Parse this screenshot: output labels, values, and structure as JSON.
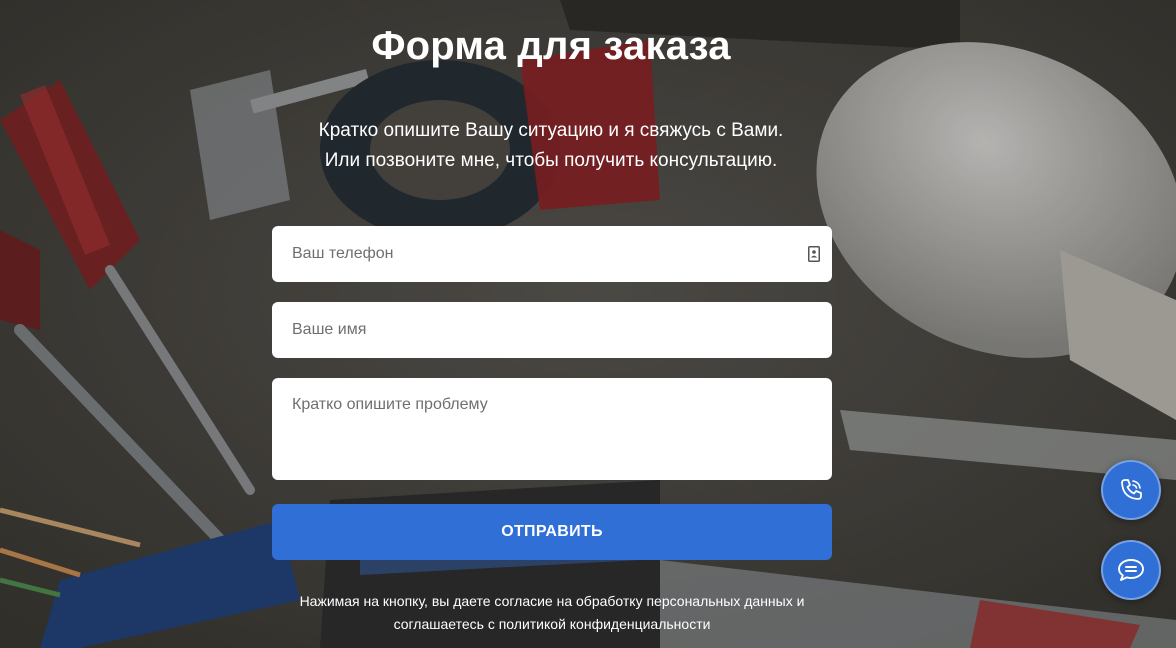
{
  "colors": {
    "accent": "#2f6fd6",
    "text_light": "#ffffff",
    "field_bg": "#ffffff",
    "placeholder": "#6f6f6f"
  },
  "form": {
    "title": "Форма для заказа",
    "subtitle_line1": "Кратко опишите Вашу ситуацию и я свяжусь с Вами.",
    "subtitle_line2": "Или позвоните мне, чтобы получить консультацию.",
    "phone_placeholder": "Ваш телефон",
    "name_placeholder": "Ваше имя",
    "message_placeholder": "Кратко опишите проблему",
    "submit_label": "ОТПРАВИТЬ",
    "consent_line1": "Нажимая на кнопку, вы даете согласие на обработку персональных данных и",
    "consent_line2": "соглашаетесь с политикой конфиденциальности"
  },
  "icons": {
    "phone_field_icon": "contact-card-icon",
    "call_button_icon": "phone-call-icon",
    "chat_button_icon": "chat-bubble-icon"
  }
}
